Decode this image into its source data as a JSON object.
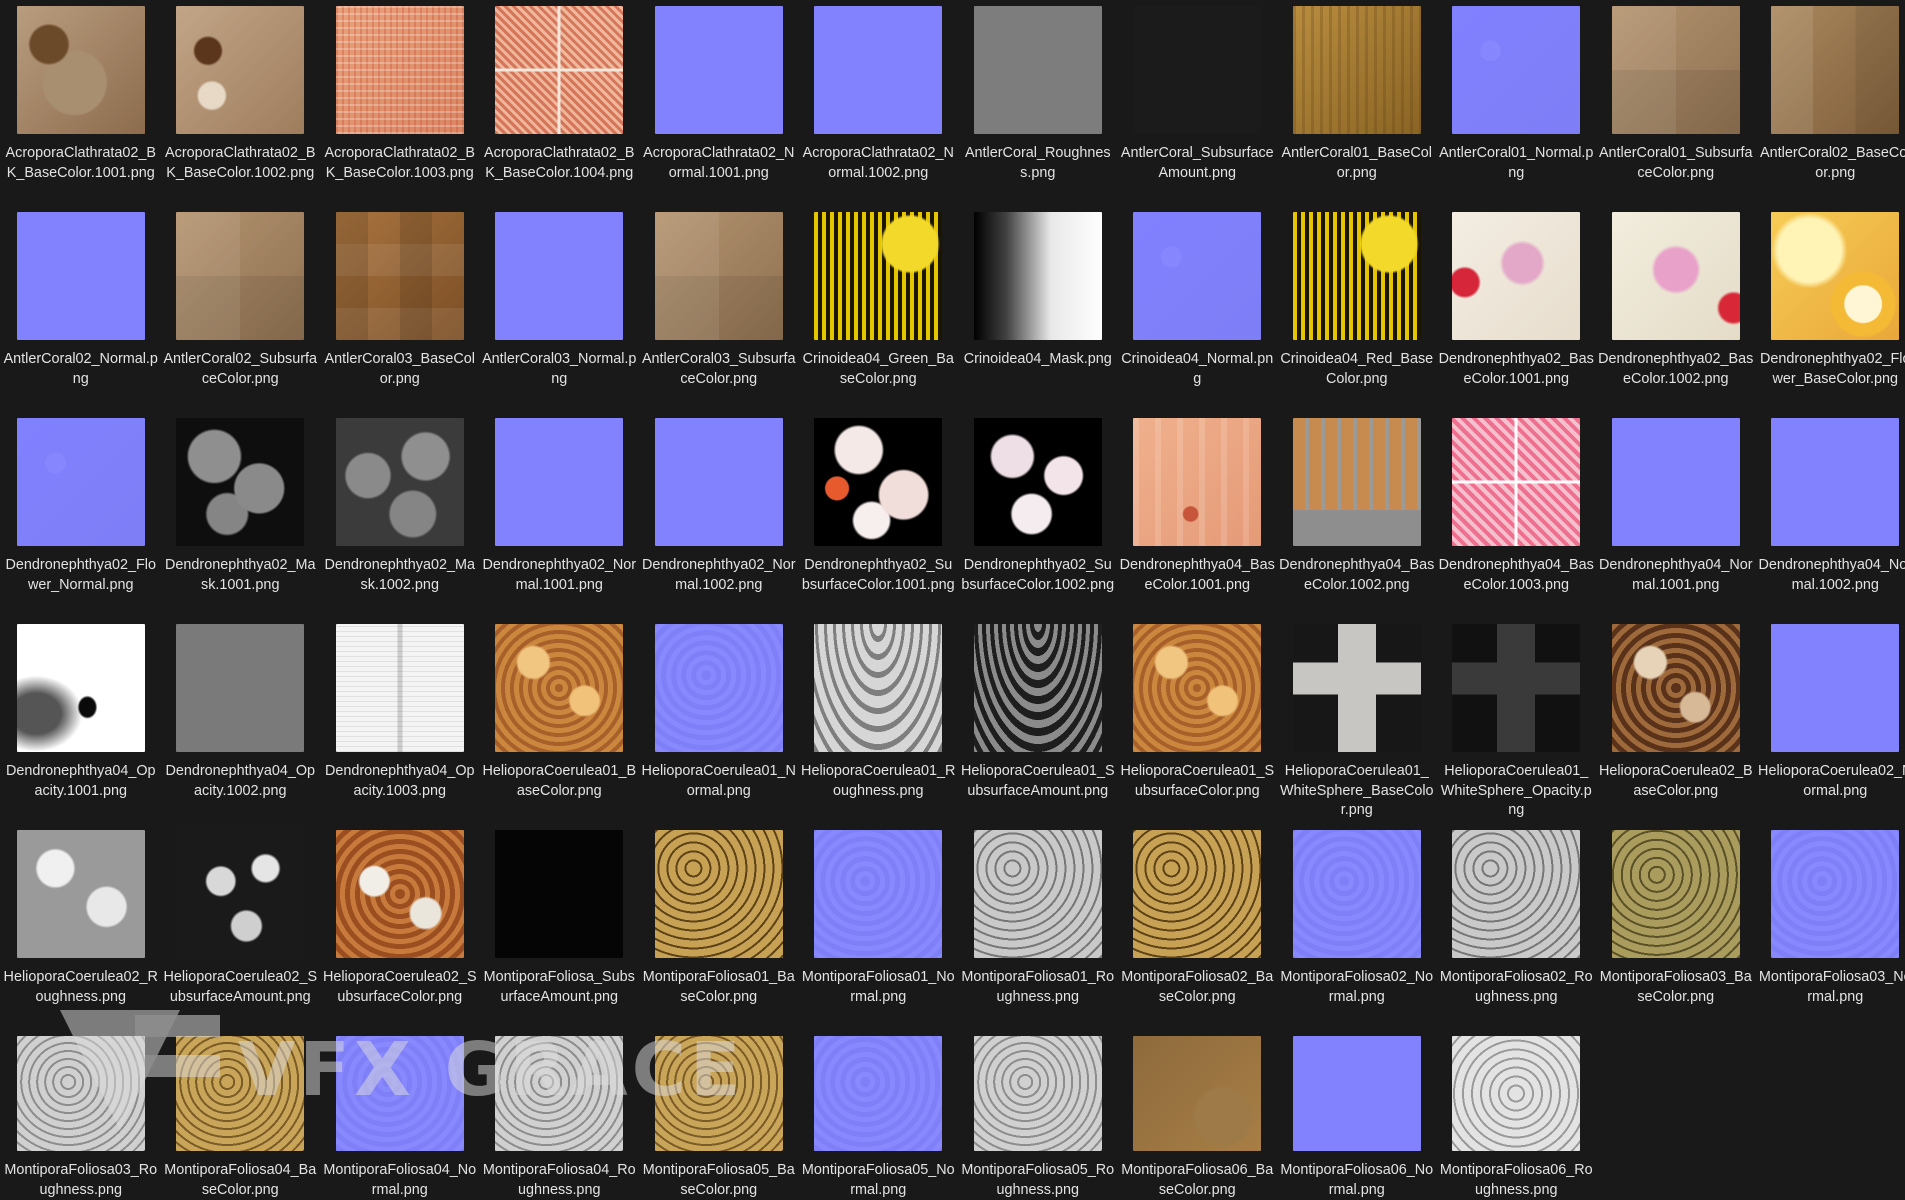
{
  "files": [
    {
      "name": "AcroporaClathrata02_BK_BaseColor.1001.png",
      "thumb": "t-beige"
    },
    {
      "name": "AcroporaClathrata02_BK_BaseColor.1002.png",
      "thumb": "t-beige2"
    },
    {
      "name": "AcroporaClathrata02_BK_BaseColor.1003.png",
      "thumb": "t-pinkgrid"
    },
    {
      "name": "AcroporaClathrata02_BK_BaseColor.1004.png",
      "thumb": "t-pinkquad"
    },
    {
      "name": "AcroporaClathrata02_Normal.1001.png",
      "thumb": "t-normal-flat"
    },
    {
      "name": "AcroporaClathrata02_Normal.1002.png",
      "thumb": "t-normal-flat"
    },
    {
      "name": "AntlerCoral_Roughness.png",
      "thumb": "t-gray"
    },
    {
      "name": "AntlerCoral_SubsurfaceAmount.png",
      "thumb": "t-black-dim"
    },
    {
      "name": "AntlerCoral01_BaseColor.png",
      "thumb": "t-gold"
    },
    {
      "name": "AntlerCoral01_Normal.png",
      "thumb": "t-normal"
    },
    {
      "name": "AntlerCoral01_SubsurfaceColor.png",
      "thumb": "t-tan"
    },
    {
      "name": "AntlerCoral02_BaseColor.png",
      "thumb": "t-tan2"
    },
    {
      "name": "AntlerCoral02_Normal.png",
      "thumb": "t-normal-flat"
    },
    {
      "name": "AntlerCoral02_SubsurfaceColor.png",
      "thumb": "t-tan"
    },
    {
      "name": "AntlerCoral03_BaseColor.png",
      "thumb": "t-brownsq"
    },
    {
      "name": "AntlerCoral03_Normal.png",
      "thumb": "t-normal-flat"
    },
    {
      "name": "AntlerCoral03_SubsurfaceColor.png",
      "thumb": "t-tan"
    },
    {
      "name": "Crinoidea04_Green_BaseColor.png",
      "thumb": "t-yellow"
    },
    {
      "name": "Crinoidea04_Mask.png",
      "thumb": "t-mask"
    },
    {
      "name": "Crinoidea04_Normal.png",
      "thumb": "t-normal"
    },
    {
      "name": "Crinoidea04_Red_BaseColor.png",
      "thumb": "t-yellow"
    },
    {
      "name": "Dendronephthya02_BaseColor.1001.png",
      "thumb": "t-pinkwhite"
    },
    {
      "name": "Dendronephthya02_BaseColor.1002.png",
      "thumb": "t-pinkwhite2"
    },
    {
      "name": "Dendronephthya02_Flower_BaseColor.png",
      "thumb": "t-flowerorange"
    },
    {
      "name": "Dendronephthya02_Flower_Normal.png",
      "thumb": "t-normal"
    },
    {
      "name": "Dendronephthya02_Mask.1001.png",
      "thumb": "t-graymaskdark"
    },
    {
      "name": "Dendronephthya02_Mask.1002.png",
      "thumb": "t-graymaskdark2"
    },
    {
      "name": "Dendronephthya02_Normal.1001.png",
      "thumb": "t-normal-flat"
    },
    {
      "name": "Dendronephthya02_Normal.1002.png",
      "thumb": "t-normal-flat"
    },
    {
      "name": "Dendronephthya02_SubsurfaceColor.1001.png",
      "thumb": "t-pinkblobs"
    },
    {
      "name": "Dendronephthya02_SubsurfaceColor.1002.png",
      "thumb": "t-pinkblobs2"
    },
    {
      "name": "Dendronephthya04_BaseColor.1001.png",
      "thumb": "t-peach"
    },
    {
      "name": "Dendronephthya04_BaseColor.1002.png",
      "thumb": "t-orangegray"
    },
    {
      "name": "Dendronephthya04_BaseColor.1003.png",
      "thumb": "t-pinkyellow"
    },
    {
      "name": "Dendronephthya04_Normal.1001.png",
      "thumb": "t-normal-flat"
    },
    {
      "name": "Dendronephthya04_Normal.1002.png",
      "thumb": "t-normal-flat"
    },
    {
      "name": "Dendronephthya04_Opacity.1001.png",
      "thumb": "t-whitesmoke"
    },
    {
      "name": "Dendronephthya04_Opacity.1002.png",
      "thumb": "t-midgray"
    },
    {
      "name": "Dendronephthya04_Opacity.1003.png",
      "thumb": "t-whitebox"
    },
    {
      "name": "HelioporaCoerulea01_BaseColor.png",
      "thumb": "t-orangecells"
    },
    {
      "name": "HelioporaCoerulea01_Normal.png",
      "thumb": "t-normaltex"
    },
    {
      "name": "HelioporaCoerulea01_Roughness.png",
      "thumb": "t-grayroughscale"
    },
    {
      "name": "HelioporaCoerulea01_SubsurfaceAmount.png",
      "thumb": "t-darkscale"
    },
    {
      "name": "HelioporaCoerulea01_SubsurfaceColor.png",
      "thumb": "t-orangecells"
    },
    {
      "name": "HelioporaCoerulea01_WhiteSphere_BaseColor.png",
      "thumb": "t-cross"
    },
    {
      "name": "HelioporaCoerulea01_WhiteSphere_Opacity.png",
      "thumb": "t-crossdark"
    },
    {
      "name": "HelioporaCoerulea02_BaseColor.png",
      "thumb": "t-brownpatch"
    },
    {
      "name": "HelioporaCoerulea02_Normal.png",
      "thumb": "t-normal-flat"
    },
    {
      "name": "HelioporaCoerulea02_Roughness.png",
      "thumb": "t-graypatch"
    },
    {
      "name": "HelioporaCoerulea02_SubsurfaceAmount.png",
      "thumb": "t-darkpatch"
    },
    {
      "name": "HelioporaCoerulea02_SubsurfaceColor.png",
      "thumb": "t-orangewhite"
    },
    {
      "name": "MontiporaFoliosa_SubsurfaceAmount.png",
      "thumb": "t-black"
    },
    {
      "name": "MontiporaFoliosa01_BaseColor.png",
      "thumb": "t-goldpebble"
    },
    {
      "name": "MontiporaFoliosa01_Normal.png",
      "thumb": "t-normaltex"
    },
    {
      "name": "MontiporaFoliosa01_Roughness.png",
      "thumb": "t-graypebble"
    },
    {
      "name": "MontiporaFoliosa02_BaseColor.png",
      "thumb": "t-goldpebble"
    },
    {
      "name": "MontiporaFoliosa02_Normal.png",
      "thumb": "t-normaltex"
    },
    {
      "name": "MontiporaFoliosa02_Roughness.png",
      "thumb": "t-graypebble"
    },
    {
      "name": "MontiporaFoliosa03_BaseColor.png",
      "thumb": "t-greengold"
    },
    {
      "name": "MontiporaFoliosa03_Normal.png",
      "thumb": "t-normaltex"
    },
    {
      "name": "MontiporaFoliosa03_Roughness.png",
      "thumb": "t-graycells"
    },
    {
      "name": "MontiporaFoliosa04_BaseColor.png",
      "thumb": "t-goldcells"
    },
    {
      "name": "MontiporaFoliosa04_Normal.png",
      "thumb": "t-normaltex"
    },
    {
      "name": "MontiporaFoliosa04_Roughness.png",
      "thumb": "t-graycells"
    },
    {
      "name": "MontiporaFoliosa05_BaseColor.png",
      "thumb": "t-goldcells"
    },
    {
      "name": "MontiporaFoliosa05_Normal.png",
      "thumb": "t-normaltex"
    },
    {
      "name": "MontiporaFoliosa05_Roughness.png",
      "thumb": "t-graycells"
    },
    {
      "name": "MontiporaFoliosa06_BaseColor.png",
      "thumb": "t-brownwater"
    },
    {
      "name": "MontiporaFoliosa06_Normal.png",
      "thumb": "t-normal-flat"
    },
    {
      "name": "MontiporaFoliosa06_Roughness.png",
      "thumb": "t-graywhitecells"
    }
  ],
  "watermark": {
    "text": "VFX GRACE"
  },
  "colors": {
    "background": "#191919",
    "label": "#e3e3e3",
    "normal_map": "#8282ff"
  }
}
